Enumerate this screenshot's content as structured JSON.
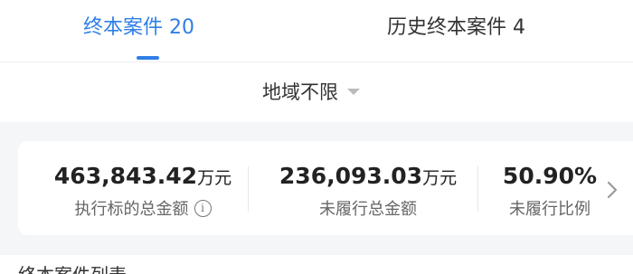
{
  "tabs": {
    "active": {
      "label": "终本案件",
      "count": "20"
    },
    "inactive": {
      "label": "历史终本案件",
      "count": "4"
    }
  },
  "filter": {
    "region_label": "地域不限"
  },
  "stats": [
    {
      "value": "463,843.42",
      "unit": "万元",
      "label": "执行标的总金额",
      "has_info": true
    },
    {
      "value": "236,093.03",
      "unit": "万元",
      "label": "未履行总金额"
    },
    {
      "value": "50.90%",
      "unit": "",
      "label": "未履行比例"
    }
  ],
  "bottom": {
    "partial_text": "终本案件列表"
  },
  "colors": {
    "accent": "#2f7fe6",
    "background_band": "#f5f6f8",
    "text_primary": "#222222",
    "text_secondary": "#666666"
  },
  "icons": {
    "info": "info-circle-icon",
    "caret": "caret-down-icon",
    "chevron": "chevron-right-icon"
  }
}
